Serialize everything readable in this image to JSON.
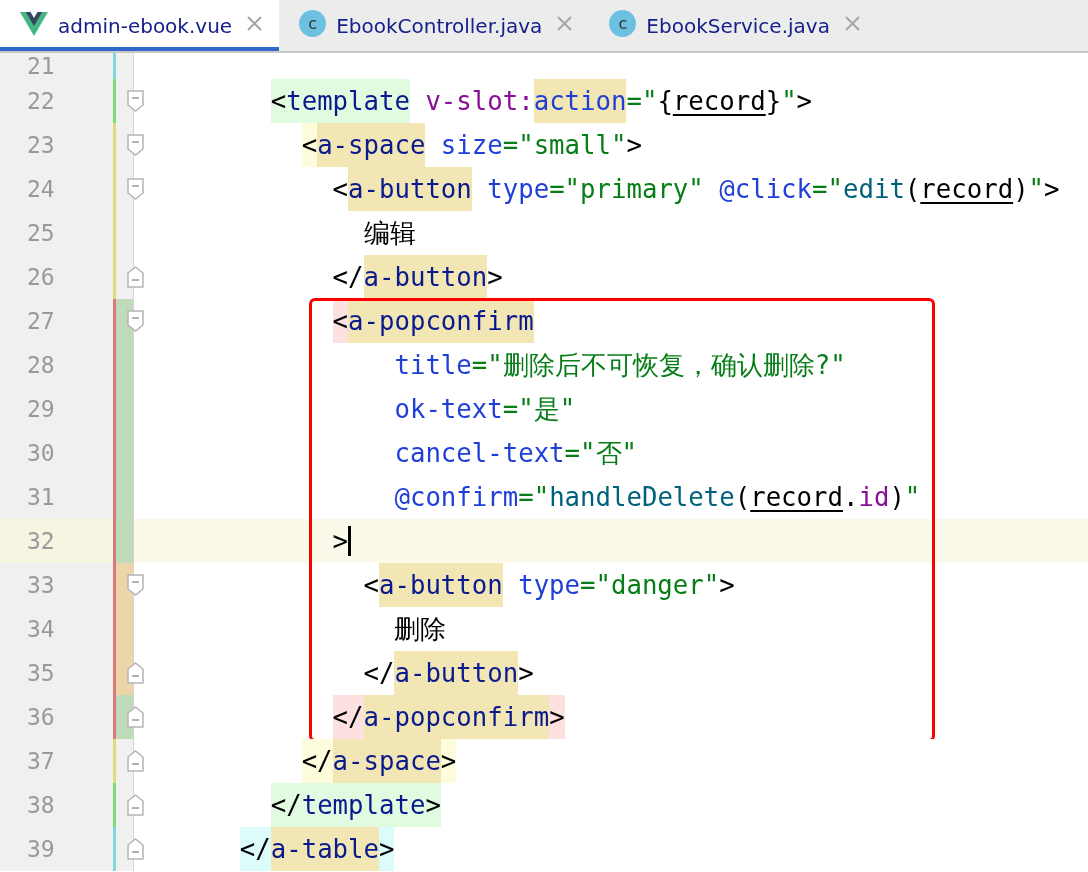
{
  "tabs": [
    {
      "label": "admin-ebook.vue",
      "kind": "vue",
      "selected": true
    },
    {
      "label": "EbookController.java",
      "kind": "class",
      "letter": "c",
      "selected": false
    },
    {
      "label": "EbookService.java",
      "kind": "class",
      "letter": "c",
      "selected": false
    }
  ],
  "annotation": {
    "color": "#ff0000"
  },
  "lines": [
    {
      "number": "21",
      "marker": {
        "color": "#80d8da"
      },
      "current": false,
      "caret": false,
      "boxed": false
    },
    {
      "number": "22",
      "marker": {
        "color": "#7fdc7a"
      },
      "fold": {
        "kind": "start"
      },
      "current": false,
      "caret": false,
      "boxed": false,
      "tokens": [
        {
          "text": "        <",
          "kind": "punct",
          "color": "#e0fbe0"
        },
        {
          "text": "template",
          "kind": "tag",
          "color": "#e0fbe0"
        },
        {
          "text": " v-slot:",
          "kind": "directive"
        },
        {
          "text": "action",
          "kind": "attr",
          "color": "#f2e6b4"
        },
        {
          "text": "=\"",
          "kind": "string"
        },
        {
          "text": "{",
          "kind": "punct"
        },
        {
          "text": "record",
          "kind": "var"
        },
        {
          "text": "}",
          "kind": "punct"
        },
        {
          "text": "\"",
          "kind": "string"
        },
        {
          "text": ">",
          "kind": "punct"
        }
      ]
    },
    {
      "number": "23",
      "marker": {
        "color": "#dedc7c"
      },
      "fold": {
        "kind": "start"
      },
      "current": false,
      "caret": false,
      "boxed": false,
      "tokens": [
        {
          "text": "          <",
          "kind": "punct",
          "color": "#fdfcdc"
        },
        {
          "text": "a-space",
          "kind": "tag",
          "color": "#f2e6b4"
        },
        {
          "text": " size",
          "kind": "attr"
        },
        {
          "text": "=\"small\"",
          "kind": "string"
        },
        {
          "text": ">",
          "kind": "punct"
        }
      ]
    },
    {
      "number": "24",
      "marker": {
        "color": "#dedc7c"
      },
      "fold": {
        "kind": "start"
      },
      "current": false,
      "caret": false,
      "boxed": false,
      "tokens": [
        {
          "text": "            <",
          "kind": "punct"
        },
        {
          "text": "a-button",
          "kind": "tag",
          "color": "#f2e6b4"
        },
        {
          "text": " type",
          "kind": "attr"
        },
        {
          "text": "=\"primary\"",
          "kind": "string"
        },
        {
          "text": " @click",
          "kind": "attr"
        },
        {
          "text": "=\"",
          "kind": "string"
        },
        {
          "text": "edit",
          "kind": "func"
        },
        {
          "text": "(",
          "kind": "punct"
        },
        {
          "text": "record",
          "kind": "var"
        },
        {
          "text": ")",
          "kind": "punct"
        },
        {
          "text": "\"",
          "kind": "string"
        },
        {
          "text": ">",
          "kind": "punct"
        }
      ]
    },
    {
      "number": "25",
      "marker": {
        "color": "#dedc7c"
      },
      "current": false,
      "caret": false,
      "boxed": false,
      "tokens": [
        {
          "text": "              编辑",
          "kind": "text"
        }
      ]
    },
    {
      "number": "26",
      "marker": {
        "color": "#dedc7c"
      },
      "fold": {
        "kind": "end"
      },
      "current": false,
      "caret": false,
      "boxed": false,
      "tokens": [
        {
          "text": "            </",
          "kind": "punct"
        },
        {
          "text": "a-button",
          "kind": "tag",
          "color": "#f2e6b4"
        },
        {
          "text": ">",
          "kind": "punct"
        }
      ]
    },
    {
      "number": "27",
      "marker": {
        "color": "#dc7a7a"
      },
      "band": {
        "color": "#bfdbb9"
      },
      "fold": {
        "kind": "start"
      },
      "current": false,
      "caret": false,
      "boxed": true,
      "tokens": [
        {
          "text": "            <",
          "kind": "punct",
          "color": "#fde0e0"
        },
        {
          "text": "a-popconfirm",
          "kind": "tag",
          "color": "#f2e6b4"
        }
      ]
    },
    {
      "number": "28",
      "marker": {
        "color": "#dc7a7a"
      },
      "band": {
        "color": "#bfdbb9"
      },
      "current": false,
      "caret": false,
      "boxed": true,
      "tokens": [
        {
          "text": "                title",
          "kind": "attr"
        },
        {
          "text": "=\"删除后不可恢复，确认删除?\"",
          "kind": "string"
        }
      ]
    },
    {
      "number": "29",
      "marker": {
        "color": "#dc7a7a"
      },
      "band": {
        "color": "#bfdbb9"
      },
      "current": false,
      "caret": false,
      "boxed": true,
      "tokens": [
        {
          "text": "                ok-text",
          "kind": "attr"
        },
        {
          "text": "=\"是\"",
          "kind": "string"
        }
      ]
    },
    {
      "number": "30",
      "marker": {
        "color": "#dc7a7a"
      },
      "band": {
        "color": "#bfdbb9"
      },
      "current": false,
      "caret": false,
      "boxed": true,
      "tokens": [
        {
          "text": "                cancel-text",
          "kind": "attr"
        },
        {
          "text": "=\"否\"",
          "kind": "string"
        }
      ]
    },
    {
      "number": "31",
      "marker": {
        "color": "#dc7a7a"
      },
      "band": {
        "color": "#bfdbb9"
      },
      "current": false,
      "caret": false,
      "boxed": true,
      "tokens": [
        {
          "text": "                @confirm",
          "kind": "attr"
        },
        {
          "text": "=\"",
          "kind": "string"
        },
        {
          "text": "handleDelete",
          "kind": "func"
        },
        {
          "text": "(",
          "kind": "punct"
        },
        {
          "text": "record",
          "kind": "var"
        },
        {
          "text": ".",
          "kind": "punct"
        },
        {
          "text": "id",
          "kind": "prop"
        },
        {
          "text": ")",
          "kind": "punct"
        },
        {
          "text": "\"",
          "kind": "string"
        }
      ]
    },
    {
      "number": "32",
      "marker": {
        "color": "#dc7a7a"
      },
      "band": {
        "color": "#bfdbb9"
      },
      "current": true,
      "caret": true,
      "boxed": true,
      "tokens": [
        {
          "text": "            >",
          "kind": "punct"
        }
      ]
    },
    {
      "number": "33",
      "marker": {
        "color": "#dc7a7a"
      },
      "band": {
        "color": "#ebd5a9"
      },
      "fold": {
        "kind": "start"
      },
      "current": false,
      "caret": false,
      "boxed": true,
      "tokens": [
        {
          "text": "              <",
          "kind": "punct"
        },
        {
          "text": "a-button",
          "kind": "tag",
          "color": "#f2e6b4"
        },
        {
          "text": " type",
          "kind": "attr"
        },
        {
          "text": "=\"danger\"",
          "kind": "string"
        },
        {
          "text": ">",
          "kind": "punct"
        }
      ]
    },
    {
      "number": "34",
      "marker": {
        "color": "#dc7a7a"
      },
      "band": {
        "color": "#ebd5a9"
      },
      "current": false,
      "caret": false,
      "boxed": true,
      "tokens": [
        {
          "text": "                删除",
          "kind": "text"
        }
      ]
    },
    {
      "number": "35",
      "marker": {
        "color": "#dc7a7a"
      },
      "band": {
        "color": "#ebd5a9"
      },
      "fold": {
        "kind": "end"
      },
      "current": false,
      "caret": false,
      "boxed": true,
      "tokens": [
        {
          "text": "              </",
          "kind": "punct"
        },
        {
          "text": "a-button",
          "kind": "tag",
          "color": "#f2e6b4"
        },
        {
          "text": ">",
          "kind": "punct"
        }
      ]
    },
    {
      "number": "36",
      "marker": {
        "color": "#dc7a7a"
      },
      "band": {
        "color": "#bfdbb9"
      },
      "fold": {
        "kind": "end"
      },
      "current": false,
      "caret": false,
      "boxed": true,
      "tokens": [
        {
          "text": "            </",
          "kind": "punct",
          "color": "#fde0e0"
        },
        {
          "text": "a-popconfirm",
          "kind": "tag",
          "color": "#f2e6b4"
        },
        {
          "text": ">",
          "kind": "punct",
          "color": "#fde0e0"
        }
      ]
    },
    {
      "number": "37",
      "marker": {
        "color": "#dedc7c"
      },
      "fold": {
        "kind": "end"
      },
      "current": false,
      "caret": false,
      "boxed": false,
      "tokens": [
        {
          "text": "          </",
          "kind": "punct",
          "color": "#fdfcdc"
        },
        {
          "text": "a-space",
          "kind": "tag",
          "color": "#f2e6b4"
        },
        {
          "text": ">",
          "kind": "punct",
          "color": "#fdfcdc"
        }
      ]
    },
    {
      "number": "38",
      "marker": {
        "color": "#7fdc7a"
      },
      "fold": {
        "kind": "end"
      },
      "current": false,
      "caret": false,
      "boxed": false,
      "tokens": [
        {
          "text": "        </",
          "kind": "punct",
          "color": "#e0fbe0"
        },
        {
          "text": "template",
          "kind": "tag",
          "color": "#e0fbe0"
        },
        {
          "text": ">",
          "kind": "punct",
          "color": "#e0fbe0"
        }
      ]
    },
    {
      "number": "39",
      "marker": {
        "color": "#80d8da"
      },
      "fold": {
        "kind": "end"
      },
      "current": false,
      "caret": false,
      "boxed": false,
      "tokens": [
        {
          "text": "      </",
          "kind": "punct",
          "color": "#dcfcfc"
        },
        {
          "text": "a-table",
          "kind": "tag",
          "color": "#f2e6b4"
        },
        {
          "text": ">",
          "kind": "punct",
          "color": "#dcfcfc"
        }
      ]
    }
  ]
}
